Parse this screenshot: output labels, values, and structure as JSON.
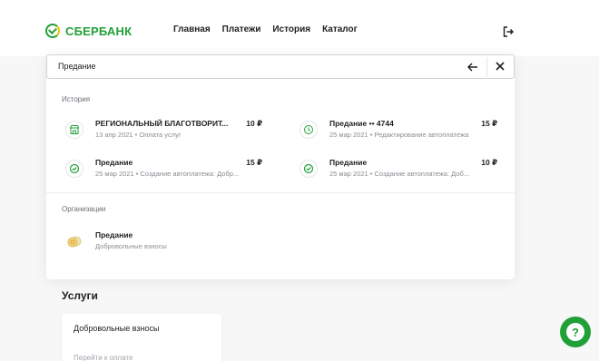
{
  "header": {
    "logo_text": "СБЕРБАНК",
    "nav": [
      "Главная",
      "Платежи",
      "История",
      "Каталог"
    ]
  },
  "search": {
    "value": "Предание"
  },
  "history": {
    "title": "История",
    "items": [
      {
        "icon": "storefront-icon",
        "title": "РЕГИОНАЛЬНЫЙ БЛАГОТВОРИТ...",
        "amount": "10 ₽",
        "sub": "13 апр 2021 • Оплата услуг"
      },
      {
        "icon": "clock-icon",
        "title": "Предание •• 4744",
        "amount": "15 ₽",
        "sub": "25 мар 2021 • Редактирование автоплатежа"
      },
      {
        "icon": "sber-check-icon",
        "title": "Предание",
        "amount": "15 ₽",
        "sub": "25 мар 2021 • Создание автоплатежа: Добр..."
      },
      {
        "icon": "sber-check-icon",
        "title": "Предание",
        "amount": "10 ₽",
        "sub": "25 мар 2021 • Создание автоплатежа: Доб..."
      }
    ]
  },
  "organizations": {
    "title": "Организации",
    "items": [
      {
        "title": "Предание",
        "sub": "Добровольные взносы"
      }
    ]
  },
  "services": {
    "title": "Услуги",
    "card_title": "Добровольные взносы",
    "card_link": "Перейти к оплате"
  },
  "colors": {
    "brand_green": "#21a038",
    "brand_yellow": "#f2c200"
  }
}
